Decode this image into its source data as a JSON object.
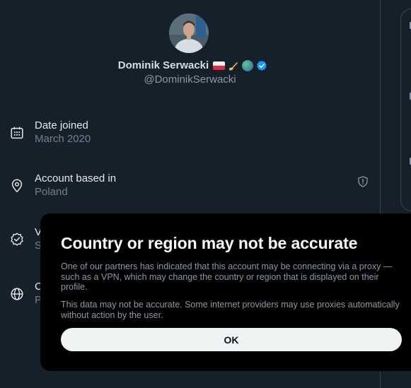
{
  "profile": {
    "display_name": "Dominik Serwacki",
    "handle": "@DominikSerwacki",
    "badges": [
      "poland-flag-emoji",
      "writing-hand-emoji",
      "globe-emoji",
      "verified-badge-icon"
    ]
  },
  "info_rows": [
    {
      "title": "Date joined",
      "value": "March 2020",
      "icon": "calendar-icon"
    },
    {
      "title": "Account based in",
      "value": "Poland",
      "icon": "location-pin-icon",
      "right_icon": "shield-alert-icon"
    },
    {
      "title": "V",
      "value": "S",
      "icon": "verified-check-icon"
    },
    {
      "title": "C",
      "value": "P",
      "icon": "globe-icon"
    }
  ],
  "modal": {
    "title": "Country or region may not be accurate",
    "paragraph_1": "One of our partners has indicated that this account may be connecting via a proxy — such as a VPN, which may change the country or region that is displayed on their profile.",
    "paragraph_2": "This data may not be accurate. Some internet providers may use proxies automatically without action by the user.",
    "ok_label": "OK"
  },
  "colors": {
    "background": "#15202b",
    "modal_background": "#000000",
    "verified_blue": "#1d9bf0",
    "muted_text": "#8b98a5"
  }
}
